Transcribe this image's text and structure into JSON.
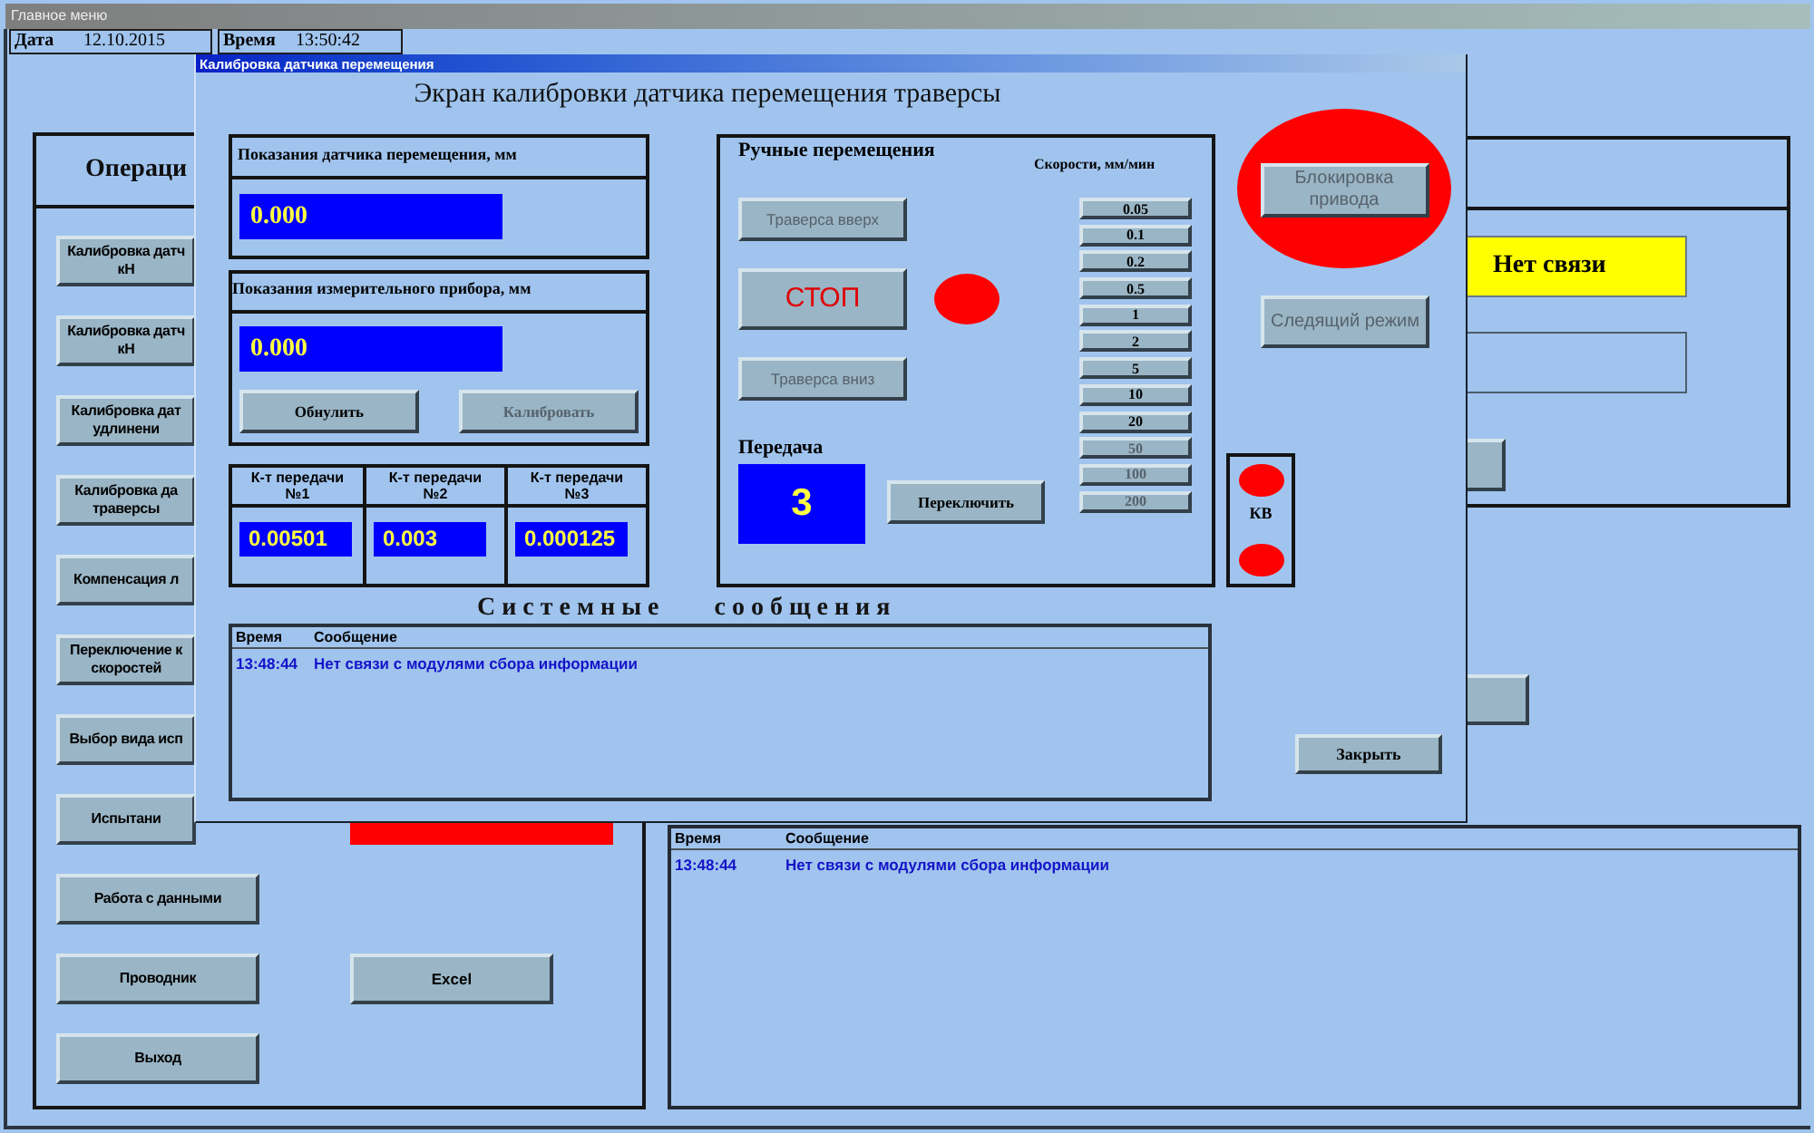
{
  "main_window": {
    "title": "Главное меню",
    "date": {
      "label": "Дата",
      "value": "12.10.2015"
    },
    "time": {
      "label": "Время",
      "value": "13:50:42"
    },
    "operations": {
      "title": "Операци",
      "buttons": [
        "Калибровка датч\nкН",
        "Калибровка датч\nкН",
        "Калибровка дат\nудлинени",
        "Калибровка да\nтраверсы",
        "Компенсация л",
        "Переключение к\nскоростей",
        "Выбор вида исп",
        "Испытани",
        "Работа с данными",
        "Проводник",
        "Выход"
      ],
      "excel_button": "Excel"
    },
    "connection_status": "Нет связи",
    "messages": {
      "columns": [
        "Время",
        "Сообщение"
      ],
      "rows": [
        {
          "time": "13:48:44",
          "text": "Нет связи с модулями сбора информации"
        }
      ]
    }
  },
  "dialog": {
    "title": "Калибровка датчика перемещения",
    "heading": "Экран калибровки датчика перемещения траверсы",
    "sensor": {
      "label": "Показания датчика перемещения, мм",
      "value": "0.000"
    },
    "instrument": {
      "label": "Показания измерительного прибора, мм",
      "value": "0.000",
      "buttons": [
        {
          "label": "Обнулить",
          "disabled": false
        },
        {
          "label": "Калибровать",
          "disabled": true
        }
      ]
    },
    "gear_ratios": [
      {
        "label": "К-т передачи\n№1",
        "value": "0.00501"
      },
      {
        "label": "К-т передачи\n№2",
        "value": "0.003"
      },
      {
        "label": "К-т передачи\n№3",
        "value": "0.000125"
      }
    ],
    "manual": {
      "title": "Ручные перемещения",
      "move_buttons": [
        {
          "kind": "move",
          "label": "Траверса вверх",
          "disabled": true
        },
        {
          "kind": "stop",
          "label": "СТОП",
          "disabled": false
        },
        {
          "kind": "move",
          "label": "Траверса вниз",
          "disabled": true
        }
      ],
      "stop_lamp": {
        "active": true
      },
      "speeds_label": "Скорости, мм/мин",
      "speeds": [
        {
          "label": "0.05",
          "disabled": false
        },
        {
          "label": "0.1",
          "disabled": false
        },
        {
          "label": "0.2",
          "disabled": false
        },
        {
          "label": "0.5",
          "disabled": false
        },
        {
          "label": "1",
          "disabled": false
        },
        {
          "label": "2",
          "disabled": false
        },
        {
          "label": "5",
          "disabled": false
        },
        {
          "label": "10",
          "disabled": false
        },
        {
          "label": "20",
          "disabled": false
        },
        {
          "label": "50",
          "disabled": true
        },
        {
          "label": "100",
          "disabled": true
        },
        {
          "label": "200",
          "disabled": true
        }
      ],
      "gear_label": "Передача",
      "gear": "3",
      "switch_button": {
        "label": "Переключить",
        "disabled": false
      }
    },
    "drive_lock": {
      "label": "Блокировка\nпривода",
      "disabled": true,
      "alarm": true
    },
    "tracking_button": {
      "label": "Следящий режим",
      "disabled": true
    },
    "limit_switch": {
      "label": "КВ",
      "lamps": [
        {
          "active": true
        },
        {
          "active": true
        }
      ]
    },
    "messages_title": "Системные сообщения",
    "messages": {
      "columns": [
        "Время",
        "Сообщение"
      ],
      "rows": [
        {
          "time": "13:48:44",
          "text": "Нет связи с модулями сбора информации"
        }
      ]
    },
    "close_button": {
      "label": "Закрыть",
      "disabled": false
    }
  }
}
